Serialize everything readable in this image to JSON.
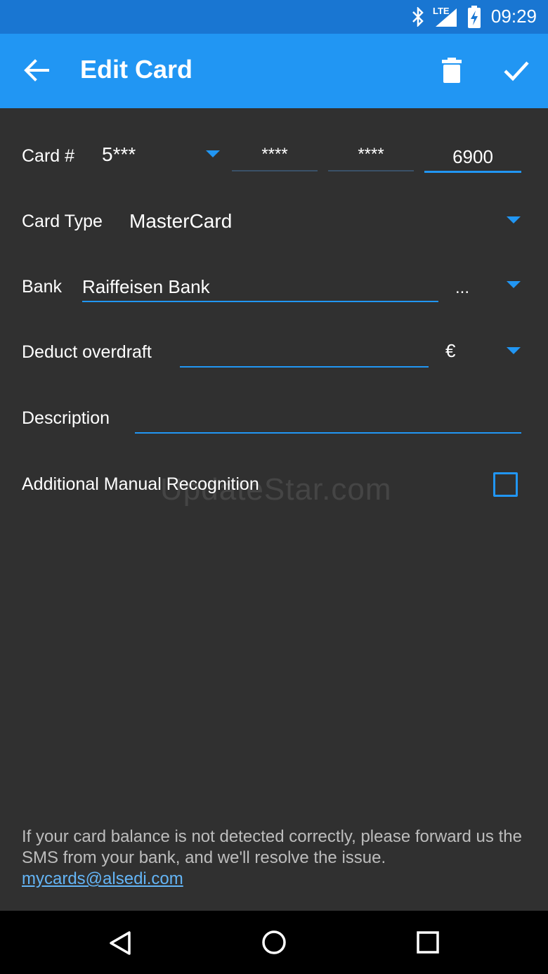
{
  "status_bar": {
    "time": "09:29",
    "network": "LTE"
  },
  "app_bar": {
    "title": "Edit Card"
  },
  "form": {
    "card_number": {
      "label": "Card #",
      "first": "5***",
      "second": "****",
      "third": "****",
      "last": "6900"
    },
    "card_type": {
      "label": "Card Type",
      "value": "MasterCard"
    },
    "bank": {
      "label": "Bank",
      "value": "Raiffeisen Bank",
      "more": "..."
    },
    "overdraft": {
      "label": "Deduct overdraft",
      "value": "",
      "currency": "€"
    },
    "description": {
      "label": "Description",
      "value": ""
    },
    "manual_recognition": {
      "label": "Additional Manual Recognition",
      "checked": false
    }
  },
  "footer": {
    "message": "If your card balance is not detected correctly, please forward us the SMS from your bank, and we'll resolve the issue.",
    "email": "mycards@alsedi.com"
  },
  "watermark": "UpdateStar.com",
  "colors": {
    "accent": "#2196f3",
    "status_bar": "#1976d2",
    "background": "#303030"
  }
}
